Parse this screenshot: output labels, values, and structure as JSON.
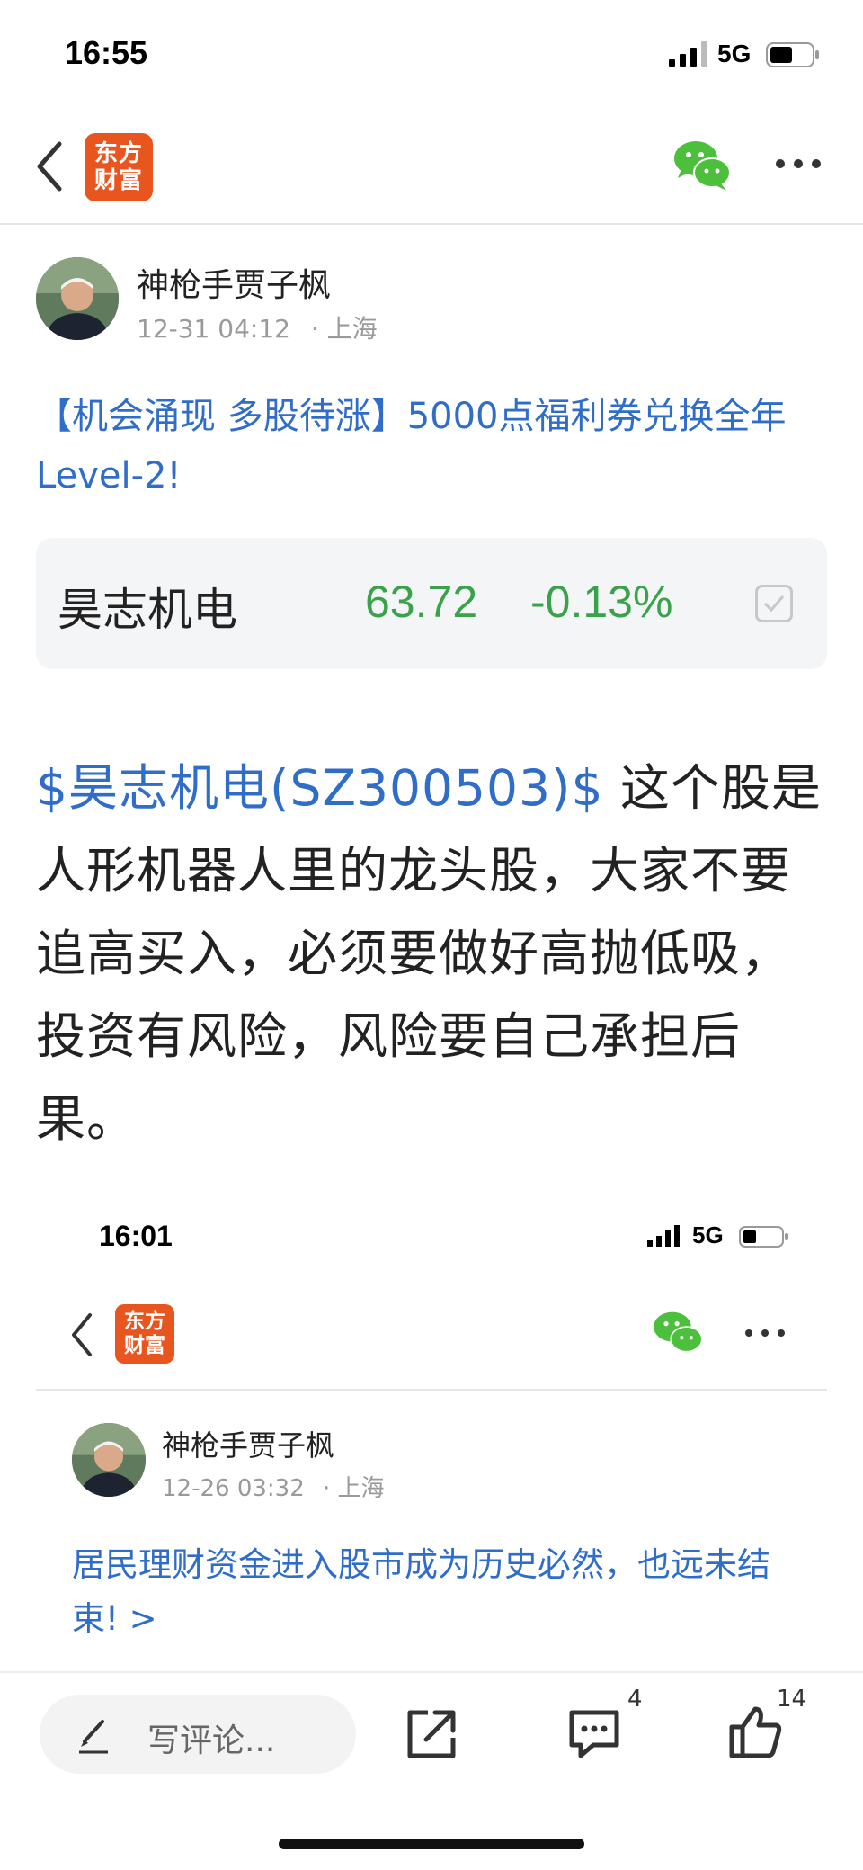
{
  "status_bar": {
    "time": "16:55",
    "network": "5G"
  },
  "nav": {
    "logo_line1": "东方",
    "logo_line2": "财富"
  },
  "author": {
    "name": "神枪手贾子枫",
    "date": "12-31 04:12",
    "location": "· 上海"
  },
  "post": {
    "title": "【机会涌现 多股待涨】5000点福利券兑换全年Level-2!",
    "stock": {
      "name": "昊志机电",
      "price": "63.72",
      "change": "-0.13%"
    },
    "body_tag": "$昊志机电(SZ300503)$",
    "body_text": "  这个股是人形机器人里的龙头股，大家不要追高买入，必须要做好高抛低吸，投资有风险，风险要自己承担后果。"
  },
  "embedded": {
    "time": "16:01",
    "network": "5G",
    "logo_line1": "东方",
    "logo_line2": "财富",
    "author_name": "神枪手贾子枫",
    "date": "12-26 03:32",
    "location": "· 上海",
    "title": "居民理财资金进入股市成为历史必然，也远未结束! >"
  },
  "bottom_bar": {
    "comment_placeholder": "写评论...",
    "comments_count": "4",
    "likes_count": "14"
  },
  "colors": {
    "accent": "#2f6dc8",
    "down_green": "#3aa24a",
    "brand": "#e8551f",
    "wechat": "#4cbf3c"
  }
}
